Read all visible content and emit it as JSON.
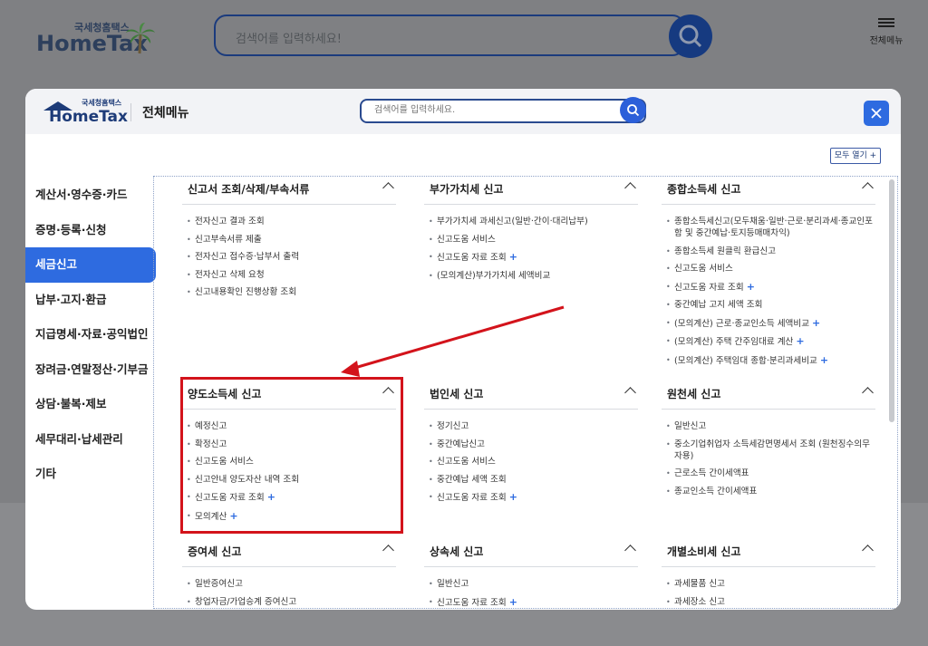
{
  "background": {
    "logo_small": "국세청홈택스",
    "logo_big": "HomeTax",
    "search_placeholder": "검색어를 입력하세요!",
    "menu_label": "전체메뉴"
  },
  "modal": {
    "logo_small": "국세청홈택스",
    "logo_big": "HomeTax",
    "title": "전체메뉴",
    "search_placeholder": "검색어를 입력하세요.",
    "open_all_label": "모두 열기 +"
  },
  "sidebar": {
    "items": [
      {
        "label": "계산서·영수증·카드"
      },
      {
        "label": "증명·등록·신청"
      },
      {
        "label": "세금신고",
        "active": true
      },
      {
        "label": "납부·고지·환급"
      },
      {
        "label": "지급명세·자료·공익법인"
      },
      {
        "label": "장려금·연말정산·기부금"
      },
      {
        "label": "상담·불복·제보"
      },
      {
        "label": "세무대리·납세관리"
      },
      {
        "label": "기타"
      }
    ]
  },
  "sections": [
    {
      "title": "신고서 조회/삭제/부속서류",
      "items": [
        "전자신고 결과 조회",
        "신고부속서류 제출",
        "전자신고 접수증·납부서 출력",
        "전자신고 삭제 요청",
        "신고내용확인 진행상황 조회"
      ]
    },
    {
      "title": "부가가치세 신고",
      "items": [
        "부가가치세 과세신고(일반·간이·대리납부)",
        "신고도움 서비스",
        "신고도움 자료 조회",
        "(모의계산)부가가치세 세액비교"
      ]
    },
    {
      "title": "종합소득세 신고",
      "items": [
        "종합소득세신고(모두채움·일반·근로·분리과세·종교인포함 및 중간예납·토지등매매차익)",
        "종합소득세 원클릭 환급신고",
        "신고도움 서비스",
        "신고도움 자료 조회",
        "중간예납 고지 세액 조회",
        "(모의계산) 근로·종교인소득 세액비교",
        "(모의계산) 주택 간주임대료 계산",
        "(모의계산) 주택임대 종합·분리과세비교"
      ]
    },
    {
      "title": "양도소득세 신고",
      "items": [
        "예정신고",
        "확정신고",
        "신고도움 서비스",
        "신고안내 양도자산 내역 조회",
        "신고도움 자료 조회",
        "모의계산"
      ]
    },
    {
      "title": "법인세 신고",
      "items": [
        "정기신고",
        "중간예납신고",
        "신고도움 서비스",
        "중간예납 세액 조회",
        "신고도움 자료 조회"
      ]
    },
    {
      "title": "원천세 신고",
      "items": [
        "일반신고",
        "중소기업취업자 소득세감면명세서 조회 (원천징수의무자용)",
        "근로소득 간이세액표",
        "종교인소득 간이세액표"
      ]
    },
    {
      "title": "증여세 신고",
      "items": [
        "일반증여신고",
        "창업자금/가업승계 증여신고"
      ]
    },
    {
      "title": "상속세 신고",
      "items": [
        "일반신고",
        "신고도움 자료 조회"
      ]
    },
    {
      "title": "개별소비세 신고",
      "items": [
        "과세물품 신고",
        "과세장소 신고"
      ]
    }
  ],
  "colors": {
    "accent": "#2e6be0",
    "highlight": "#d3131b",
    "brand_navy": "#1d3b78"
  }
}
